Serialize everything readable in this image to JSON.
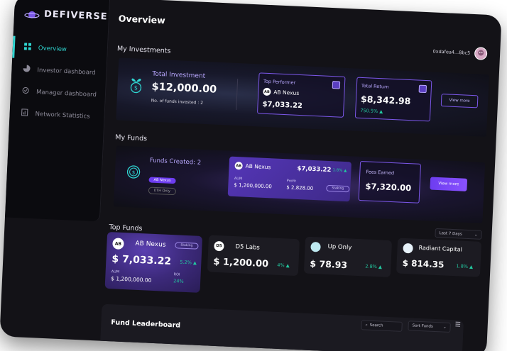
{
  "app": {
    "logo_text": "DEFIVERSE"
  },
  "sidebar": {
    "items": [
      {
        "label": "Overview",
        "icon": "grid-icon",
        "active": true
      },
      {
        "label": "Investor dashboard",
        "icon": "pie-chart-icon"
      },
      {
        "label": "Manager dashboard",
        "icon": "check-circle-icon"
      },
      {
        "label": "Network Statistics",
        "icon": "document-chart-icon"
      }
    ]
  },
  "header": {
    "title": "Overview",
    "wallet": "0xdafea4...8bc5"
  },
  "investments": {
    "title": "My Investments",
    "total_label": "Total Investment",
    "total_value": "$12,000.00",
    "funds_invested": "No. of funds invested : 2",
    "top_performer_label": "Top Performer",
    "top_performer_name": "AB Nexus",
    "top_performer_value": "$7,033.22",
    "total_return_label": "Total Return",
    "total_return_value": "$8,342.98",
    "total_return_change": "750.5%",
    "view_more": "View more"
  },
  "my_funds": {
    "title": "My Funds",
    "created_label": "Funds Created: 2",
    "tag1": "AB Nexus",
    "tag2": "ETH Only",
    "fund_name": "AB Nexus",
    "fund_value": "$7,033.22",
    "fund_change": "1.8%",
    "aum_label": "AUM",
    "aum_value": "$ 1,200,000.00",
    "profit_label": "Profit",
    "profit_value": "$ 2,828.00",
    "fund_badge": "Staking",
    "fees_label": "Fees Earned",
    "fees_value": "$7,320.00",
    "view_more": "View more"
  },
  "top_funds": {
    "title": "Top Funds",
    "period": "Last 7 Days",
    "cards": [
      {
        "name": "AB Nexus",
        "value": "$ 7,033.22",
        "change": "5.2%",
        "badge": "Staking",
        "aum_label": "AUM",
        "aum": "$ 1,200,000.00",
        "roi_label": "ROI",
        "roi": "24%"
      },
      {
        "name": "D5 Labs",
        "value": "$ 1,200.00",
        "change": "4%"
      },
      {
        "name": "Up Only",
        "value": "$ 78.93",
        "change": "2.8%"
      },
      {
        "name": "Radiant Capital",
        "value": "$ 814.35",
        "change": "1.8%"
      }
    ]
  },
  "leaderboard": {
    "title": "Fund Leaderboard",
    "search_placeholder": "Search",
    "sort_label": "Sort Funds"
  },
  "colors": {
    "accent": "#2fd6d1",
    "purple": "#7b57e8",
    "positive": "#23c9a0"
  }
}
